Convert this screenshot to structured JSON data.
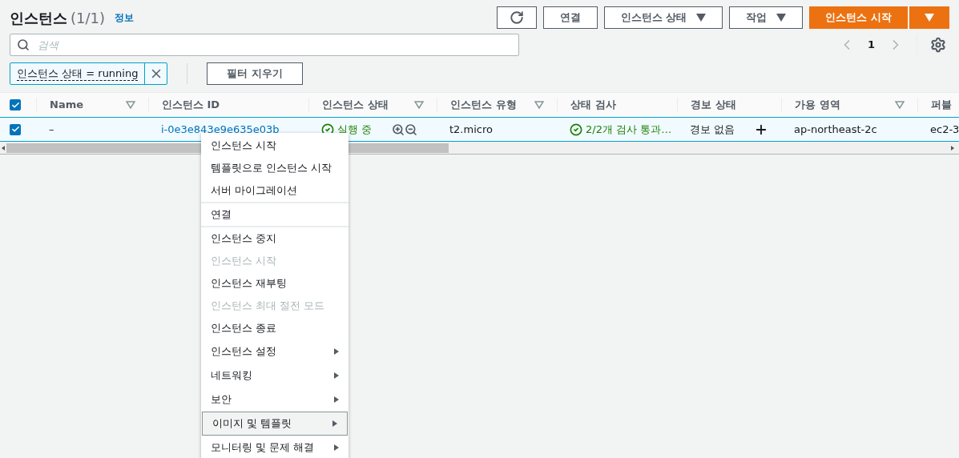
{
  "header": {
    "title": "인스턴스",
    "count": "(1/1)",
    "info_link": "정보"
  },
  "toolbar": {
    "buttons": [
      {
        "kind": "icon"
      },
      {
        "kind": "plain",
        "label": "연결"
      },
      {
        "kind": "dropdown",
        "label": "인스턴스 상태"
      },
      {
        "kind": "dropdown",
        "label": "작업"
      }
    ],
    "primary": {
      "label": "인스턴스 시작"
    }
  },
  "search": {
    "placeholder": "검색"
  },
  "pagination": {
    "page": "1"
  },
  "filter": {
    "token": "인스턴스 상태 = running",
    "clear_button": "필터 지우기"
  },
  "table": {
    "all_checked": true,
    "columns": [
      {
        "label": "Name",
        "filterable": true
      },
      {
        "label": "인스턴스 ID",
        "filterable": false
      },
      {
        "label": "인스턴스 상태",
        "filterable": true
      },
      {
        "label": "인스턴스 유형",
        "filterable": true
      },
      {
        "label": "상태 검사",
        "filterable": false
      },
      {
        "label": "경보 상태",
        "filterable": false
      },
      {
        "label": "가용 영역",
        "filterable": true
      },
      {
        "label": "퍼블"
      }
    ],
    "rows": [
      {
        "checked": true,
        "selected": true,
        "name": "–",
        "instance_id": "i-0e3e843e9e635e03b",
        "state": "실행 중",
        "type": "t2.micro",
        "status_check": "2/2개 검사 통과…",
        "alarm": "경보 없음",
        "zone": "ap-northeast-2c",
        "public": "ec2-3"
      }
    ]
  },
  "context_menu": {
    "groups": [
      [
        {
          "label": "인스턴스 시작",
          "disabled": false,
          "submenu": false,
          "highlighted": false
        },
        {
          "label": "템플릿으로 인스턴스 시작",
          "disabled": false,
          "submenu": false,
          "highlighted": false
        },
        {
          "label": "서버 마이그레이션",
          "disabled": false,
          "submenu": false,
          "highlighted": false
        }
      ],
      [
        {
          "label": "연결",
          "disabled": false,
          "submenu": false,
          "highlighted": false
        }
      ],
      [
        {
          "label": "인스턴스 중지",
          "disabled": false,
          "submenu": false,
          "highlighted": false
        },
        {
          "label": "인스턴스 시작",
          "disabled": true,
          "submenu": false,
          "highlighted": false
        },
        {
          "label": "인스턴스 재부팅",
          "disabled": false,
          "submenu": false,
          "highlighted": false
        },
        {
          "label": "인스턴스 최대 절전 모드",
          "disabled": true,
          "submenu": false,
          "highlighted": false
        },
        {
          "label": "인스턴스 종료",
          "disabled": false,
          "submenu": false,
          "highlighted": false
        },
        {
          "label": "인스턴스 설정",
          "disabled": false,
          "submenu": true,
          "highlighted": false
        },
        {
          "label": "네트워킹",
          "disabled": false,
          "submenu": true,
          "highlighted": false
        },
        {
          "label": "보안",
          "disabled": false,
          "submenu": true,
          "highlighted": false
        },
        {
          "label": "이미지 및 템플릿",
          "disabled": false,
          "submenu": true,
          "highlighted": true
        },
        {
          "label": "모니터링 및 문제 해결",
          "disabled": false,
          "submenu": true,
          "highlighted": false
        }
      ]
    ]
  }
}
